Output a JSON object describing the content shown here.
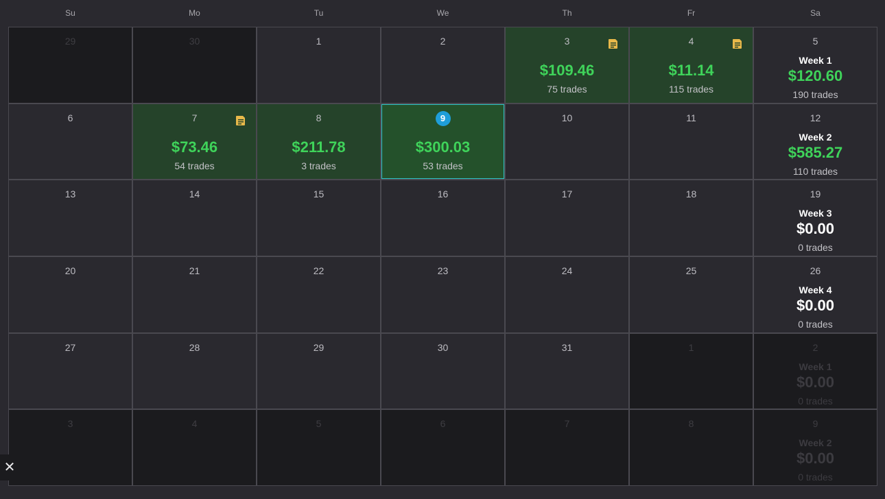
{
  "weekdays": [
    "Su",
    "Mo",
    "Tu",
    "We",
    "Th",
    "Fr",
    "Sa"
  ],
  "rows": [
    {
      "days": [
        {
          "day": "29",
          "outside": true
        },
        {
          "day": "30",
          "outside": true
        },
        {
          "day": "1"
        },
        {
          "day": "2"
        },
        {
          "day": "3",
          "amount": "$109.46",
          "trades": "75 trades",
          "note": true
        },
        {
          "day": "4",
          "amount": "$11.14",
          "trades": "115 trades",
          "note": true
        }
      ],
      "week": {
        "day": "5",
        "label": "Week 1",
        "amount": "$120.60",
        "trades": "190 trades",
        "positive": true
      }
    },
    {
      "days": [
        {
          "day": "6"
        },
        {
          "day": "7",
          "amount": "$73.46",
          "trades": "54 trades",
          "note": true
        },
        {
          "day": "8",
          "amount": "$211.78",
          "trades": "3 trades"
        },
        {
          "day": "9",
          "amount": "$300.03",
          "trades": "53 trades",
          "today": true
        },
        {
          "day": "10"
        },
        {
          "day": "11"
        }
      ],
      "week": {
        "day": "12",
        "label": "Week 2",
        "amount": "$585.27",
        "trades": "110 trades",
        "positive": true
      }
    },
    {
      "days": [
        {
          "day": "13"
        },
        {
          "day": "14"
        },
        {
          "day": "15"
        },
        {
          "day": "16"
        },
        {
          "day": "17"
        },
        {
          "day": "18"
        }
      ],
      "week": {
        "day": "19",
        "label": "Week 3",
        "amount": "$0.00",
        "trades": "0 trades"
      }
    },
    {
      "days": [
        {
          "day": "20"
        },
        {
          "day": "21"
        },
        {
          "day": "22"
        },
        {
          "day": "23"
        },
        {
          "day": "24"
        },
        {
          "day": "25"
        }
      ],
      "week": {
        "day": "26",
        "label": "Week 4",
        "amount": "$0.00",
        "trades": "0 trades"
      }
    },
    {
      "days": [
        {
          "day": "27"
        },
        {
          "day": "28"
        },
        {
          "day": "29"
        },
        {
          "day": "30"
        },
        {
          "day": "31"
        },
        {
          "day": "1",
          "outside": true
        }
      ],
      "week": {
        "day": "2",
        "label": "Week 1",
        "amount": "$0.00",
        "trades": "0 trades",
        "outside": true
      }
    },
    {
      "days": [
        {
          "day": "3",
          "outside": true
        },
        {
          "day": "4",
          "outside": true
        },
        {
          "day": "5",
          "outside": true
        },
        {
          "day": "6",
          "outside": true
        },
        {
          "day": "7",
          "outside": true
        },
        {
          "day": "8",
          "outside": true
        }
      ],
      "week": {
        "day": "9",
        "label": "Week 2",
        "amount": "$0.00",
        "trades": "0 trades",
        "outside": true
      }
    }
  ],
  "close_glyph": "✕",
  "colors": {
    "profit": "#3fd35a",
    "today_badge": "#1f9ed9",
    "note_icon": "#e8b84a",
    "selected_border": "#2ec4c7"
  }
}
